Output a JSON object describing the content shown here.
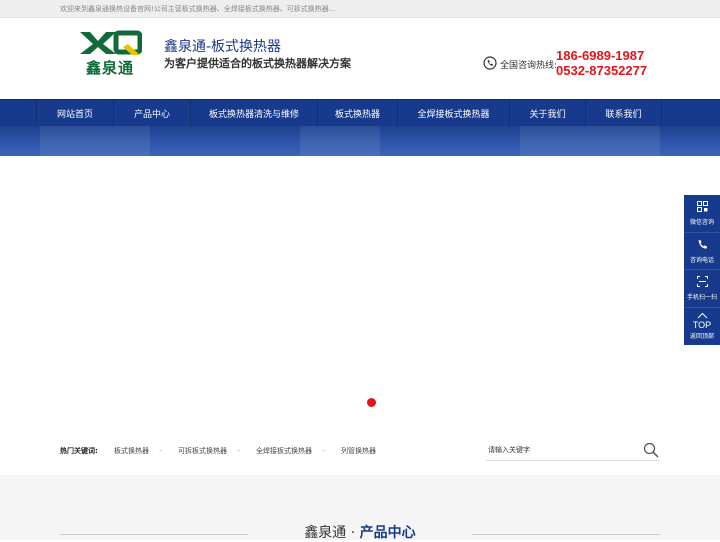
{
  "topbar": {
    "welcome": "欢迎来到鑫泉通换热设备官网!公司主营板式换热器、全焊接板式换热器、可拆式换热器..."
  },
  "header": {
    "logo_text": "鑫泉通",
    "brand_title": "鑫泉通-板式换热器",
    "brand_slogan": "为客户提供适合的板式换热器解决方案",
    "hotline_label": "全国咨询热线:",
    "phones": [
      "186-6989-1987",
      "0532-87352277"
    ]
  },
  "nav": {
    "items": [
      {
        "label": "网站首页"
      },
      {
        "label": "产品中心"
      },
      {
        "label": "板式换热器清洗与维修"
      },
      {
        "label": "板式换热器"
      },
      {
        "label": "全焊接板式换热器"
      },
      {
        "label": "关于我们"
      },
      {
        "label": "联系我们"
      }
    ]
  },
  "keywords": {
    "label": "热门关键词:",
    "items": [
      "板式换热器",
      "可拆板式换热器",
      "全焊接板式换热器",
      "列管换热器"
    ]
  },
  "search": {
    "placeholder": "请输入关键字"
  },
  "section": {
    "title_prefix": "鑫泉通 · ",
    "title_accent": "产品中心"
  },
  "side_tools": {
    "wechat": "微信咨询",
    "phone": "咨询电话",
    "mobile": "手机扫一扫",
    "top_text": "TOP",
    "top_label": "返回顶部"
  },
  "colors": {
    "nav_blue": "#173a8c",
    "phone_red": "#e4141b",
    "logo_green": "#0f6b3a"
  }
}
